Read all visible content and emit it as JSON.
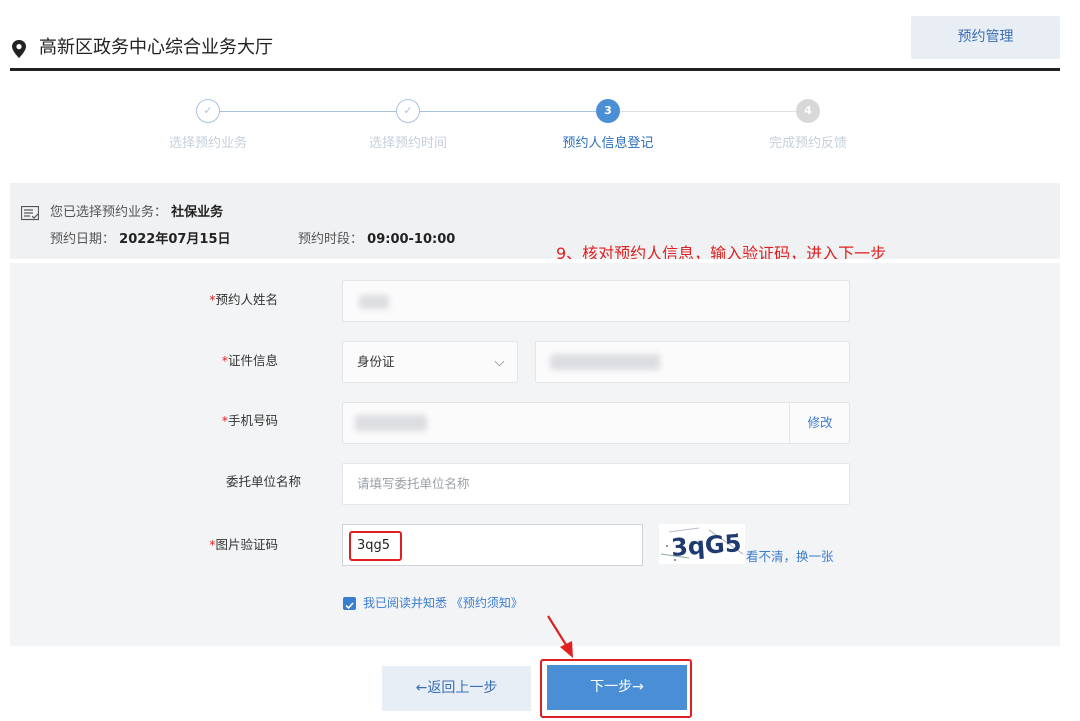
{
  "header": {
    "title": "高新区政务中心综合业务大厅",
    "manage_button": "预约管理",
    "icon": "location-pin-icon"
  },
  "steps": [
    {
      "number": "✓",
      "label": "选择预约业务",
      "state": "done"
    },
    {
      "number": "✓",
      "label": "选择预约时间",
      "state": "done"
    },
    {
      "number": "3",
      "label": "预约人信息登记",
      "state": "active"
    },
    {
      "number": "4",
      "label": "完成预约反馈",
      "state": "todo"
    }
  ],
  "summary": {
    "service_label": "您已选择预约业务：",
    "service_value": "社保业务",
    "date_label": "预约日期：",
    "date_value": "2022年07月15日",
    "slot_label": "预约时段：",
    "slot_value": "09:00-10:00"
  },
  "annotation": "9、核对预约人信息，输入验证码，进入下一步",
  "form": {
    "required_mark": "*",
    "name_label": "预约人姓名",
    "id_label": "证件信息",
    "id_type_value": "身份证",
    "phone_label": "手机号码",
    "phone_modify": "修改",
    "company_label": "委托单位名称",
    "company_placeholder": "请填写委托单位名称",
    "captcha_label": "图片验证码",
    "captcha_value": "3qg5",
    "captcha_image_text": "3qG5",
    "captcha_refresh": "看不清，换一张",
    "agree_text": "我已阅读并知悉 《预约须知》"
  },
  "buttons": {
    "back": "←返回上一步",
    "next": "下一步→"
  },
  "colors": {
    "accent": "#4a8fd6",
    "link": "#3a7cd0",
    "annotation_red": "#e02020"
  }
}
